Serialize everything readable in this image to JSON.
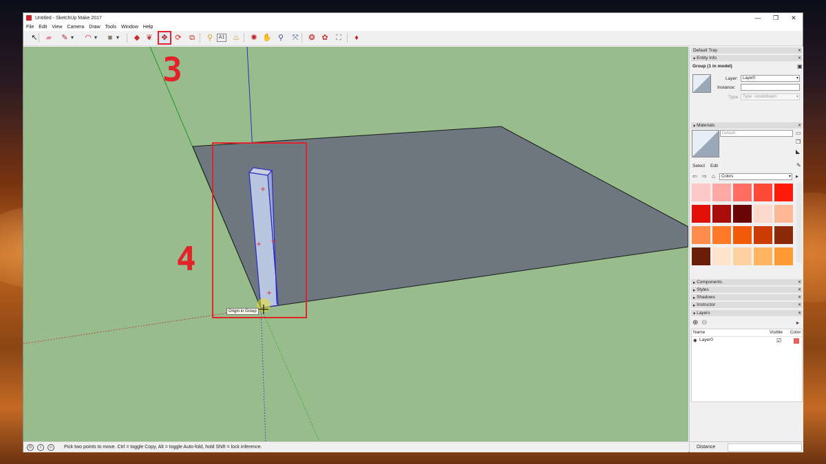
{
  "window": {
    "title": "Untitled - SketchUp Make 2017",
    "controls": [
      "—",
      "❐",
      "✕"
    ]
  },
  "menu": [
    "File",
    "Edit",
    "View",
    "Camera",
    "Draw",
    "Tools",
    "Window",
    "Help"
  ],
  "toolbar": {
    "tools": [
      {
        "name": "select-tool-icon",
        "glyph": "↖",
        "color": "#222222"
      },
      {
        "name": "eraser-tool-icon",
        "glyph": "▰",
        "color": "#e88aa0"
      },
      {
        "name": "line-tool-icon",
        "glyph": "✎",
        "color": "#c02020"
      },
      {
        "name": "line-dropdown-icon",
        "glyph": "▾",
        "color": "#333333"
      },
      {
        "name": "arc-tool-icon",
        "glyph": "◠",
        "color": "#c02020"
      },
      {
        "name": "arc-dropdown-icon",
        "glyph": "▾",
        "color": "#333333"
      },
      {
        "name": "rectangle-tool-icon",
        "glyph": "■",
        "color": "#8a7a6a"
      },
      {
        "name": "shape-dropdown-icon",
        "glyph": "▾",
        "color": "#333333"
      },
      {
        "name": "push-pull-tool-icon",
        "glyph": "◆",
        "color": "#c03030"
      },
      {
        "name": "offset-tool-icon",
        "glyph": "❦",
        "color": "#c03030"
      },
      {
        "name": "move-tool-icon",
        "glyph": "✥",
        "color": "#b01818"
      },
      {
        "name": "rotate-tool-icon",
        "glyph": "⟳",
        "color": "#d02020"
      },
      {
        "name": "scale-tool-icon",
        "glyph": "⧉",
        "color": "#c03030"
      },
      {
        "name": "tape-measure-icon",
        "glyph": "⚲",
        "color": "#d8a020"
      },
      {
        "name": "text-tool-icon",
        "glyph": "A1",
        "color": "#444444"
      },
      {
        "name": "paint-bucket-icon",
        "glyph": "♨",
        "color": "#c09020"
      },
      {
        "name": "orbit-tool-icon",
        "glyph": "✺",
        "color": "#c02020"
      },
      {
        "name": "pan-tool-icon",
        "glyph": "✋",
        "color": "#d8a860"
      },
      {
        "name": "zoom-tool-icon",
        "glyph": "⚲",
        "color": "#3a5a9a"
      },
      {
        "name": "zoom-extents-icon",
        "glyph": "⤧",
        "color": "#3a5a9a"
      },
      {
        "name": "warehouse-icon",
        "glyph": "❂",
        "color": "#c02020"
      },
      {
        "name": "extension-warehouse-icon",
        "glyph": "✿",
        "color": "#c03030"
      },
      {
        "name": "share-model-icon",
        "glyph": "⛶",
        "color": "#707070"
      },
      {
        "name": "extension-store-icon",
        "glyph": "♦",
        "color": "#c02020"
      }
    ]
  },
  "viewport": {
    "bg_color": "#98bc8c",
    "tooltip": "Origin in Group",
    "callouts": [
      "3",
      "4"
    ],
    "callout_color": "#e2232a"
  },
  "tray": {
    "title": "Default Tray",
    "entity_info": {
      "title": "Entity Info",
      "heading": "Group (1 in model)",
      "layer_label": "Layer:",
      "layer_value": "Layer0",
      "instance_label": "Instance:",
      "instance_value": "",
      "type_label": "Type:",
      "type_value": "Type: <undefined>"
    },
    "materials": {
      "title": "Materials",
      "name_value": "Default",
      "tabs": [
        "Select",
        "Edit"
      ],
      "library": "Colors",
      "swatches": [
        "#ffc8c8",
        "#ffa8a4",
        "#ff6e60",
        "#ff4a38",
        "#ff1a0a",
        "#e21006",
        "#a80d0a",
        "#6a0505",
        "#ffd8cc",
        "#ffb896",
        "#ff8c4c",
        "#ff7a28",
        "#f25a0a",
        "#cc3c02",
        "#8a2a06",
        "#6a1e08",
        "#ffe4cc",
        "#ffd2a2",
        "#ffb460",
        "#ff9a32"
      ]
    },
    "collapsed_panels": [
      "Components",
      "Styles",
      "Shadows",
      "Instructor"
    ],
    "layers": {
      "title": "Layers",
      "col_name": "Name",
      "col_visible": "Visible",
      "col_color": "Color",
      "rows": [
        {
          "name": "Layer0",
          "visible": true,
          "color": "#e86060"
        }
      ]
    }
  },
  "status": {
    "text": "Pick two points to move.  Ctrl = toggle Copy, Alt = toggle Auto-fold, hold Shift = lock inference.",
    "vcb_label": "Distance",
    "vcb_value": ""
  }
}
